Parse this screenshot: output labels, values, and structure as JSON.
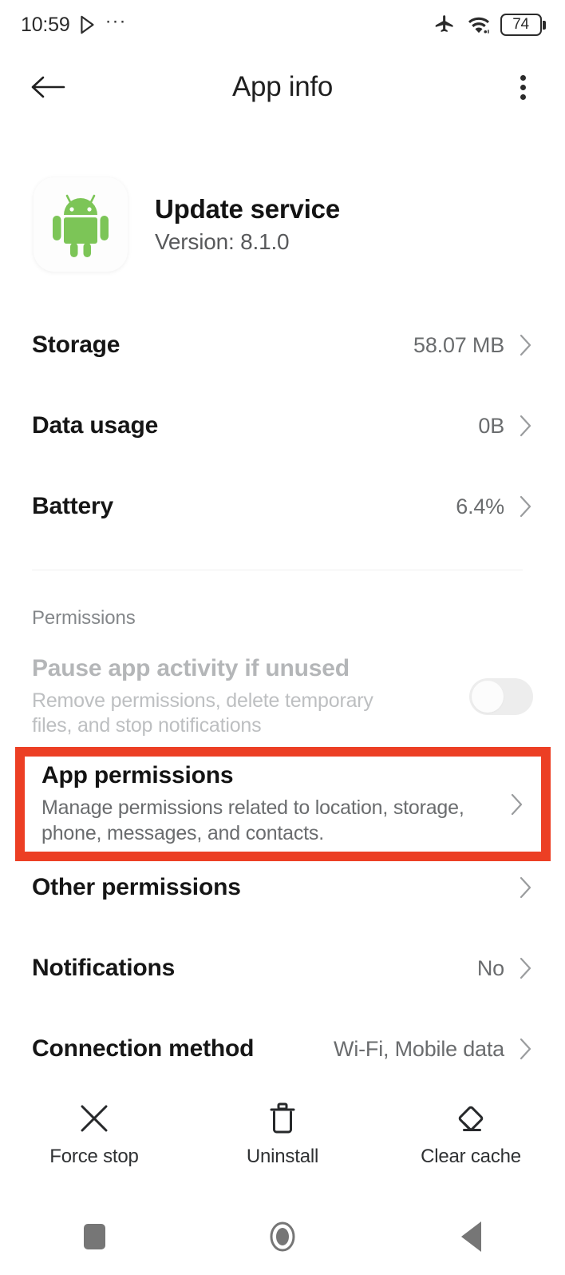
{
  "statusbar": {
    "time": "10:59",
    "playstore_icon": "play-store-icon",
    "more_notifications": "···",
    "airplane_icon": "airplane-mode-icon",
    "wifi_icon": "wifi-icon",
    "battery_level": "74"
  },
  "appbar": {
    "back_icon": "back-arrow-icon",
    "title": "App info",
    "overflow_icon": "overflow-menu-icon"
  },
  "app": {
    "icon": "android-robot-icon",
    "name": "Update service",
    "version": "Version: 8.1.0"
  },
  "rows": [
    {
      "title": "Storage",
      "value": "58.07 MB"
    },
    {
      "title": "Data usage",
      "value": "0B"
    },
    {
      "title": "Battery",
      "value": "6.4%"
    }
  ],
  "permissions": {
    "section_label": "Permissions",
    "pause": {
      "title": "Pause app activity if unused",
      "subtitle": "Remove permissions, delete temporary files, and stop notifications",
      "toggle_state": "off",
      "disabled": true
    },
    "app_permissions": {
      "title": "App permissions",
      "subtitle": "Manage permissions related to location, storage, phone, messages, and contacts.",
      "highlighted": true,
      "highlight_color": "#ec3f24"
    },
    "other_rows": [
      {
        "title": "Other permissions",
        "value": ""
      },
      {
        "title": "Notifications",
        "value": "No"
      },
      {
        "title": "Connection method",
        "value": "Wi-Fi, Mobile data"
      }
    ]
  },
  "actions": [
    {
      "label": "Force stop",
      "icon": "close-x-icon"
    },
    {
      "label": "Uninstall",
      "icon": "trash-icon"
    },
    {
      "label": "Clear cache",
      "icon": "eraser-icon"
    }
  ],
  "navbar": [
    {
      "name": "recents",
      "icon": "square-icon"
    },
    {
      "name": "home",
      "icon": "circle-icon"
    },
    {
      "name": "back",
      "icon": "triangle-back-icon"
    }
  ]
}
